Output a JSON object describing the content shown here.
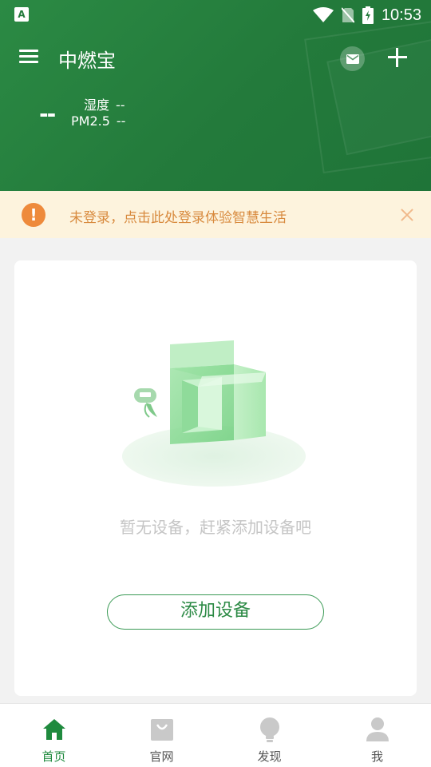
{
  "status_bar": {
    "time": "10:53",
    "app_icon_letter": "A"
  },
  "header": {
    "title": "中燃宝",
    "env": {
      "main_value": "--",
      "humidity_label": "湿度",
      "humidity_value": "--",
      "pm_label": "PM2.5",
      "pm_value": "--"
    }
  },
  "banner": {
    "text": "未登录，点击此处登录体验智慧生活",
    "warn_symbol": "!"
  },
  "empty_state": {
    "message": "暂无设备，赶紧添加设备吧",
    "button_label": "添加设备"
  },
  "bottom_nav": [
    {
      "label": "首页",
      "icon": "home-icon",
      "active": true
    },
    {
      "label": "官网",
      "icon": "shopping-bag-icon",
      "active": false
    },
    {
      "label": "发现",
      "icon": "lightbulb-icon",
      "active": false
    },
    {
      "label": "我",
      "icon": "user-icon",
      "active": false
    }
  ],
  "colors": {
    "header_green": "#237a3b",
    "accent_green": "#2c8a45",
    "banner_bg": "#fdf3dd",
    "banner_text": "#d88a3e",
    "warn_orange": "#ee8a3b"
  }
}
